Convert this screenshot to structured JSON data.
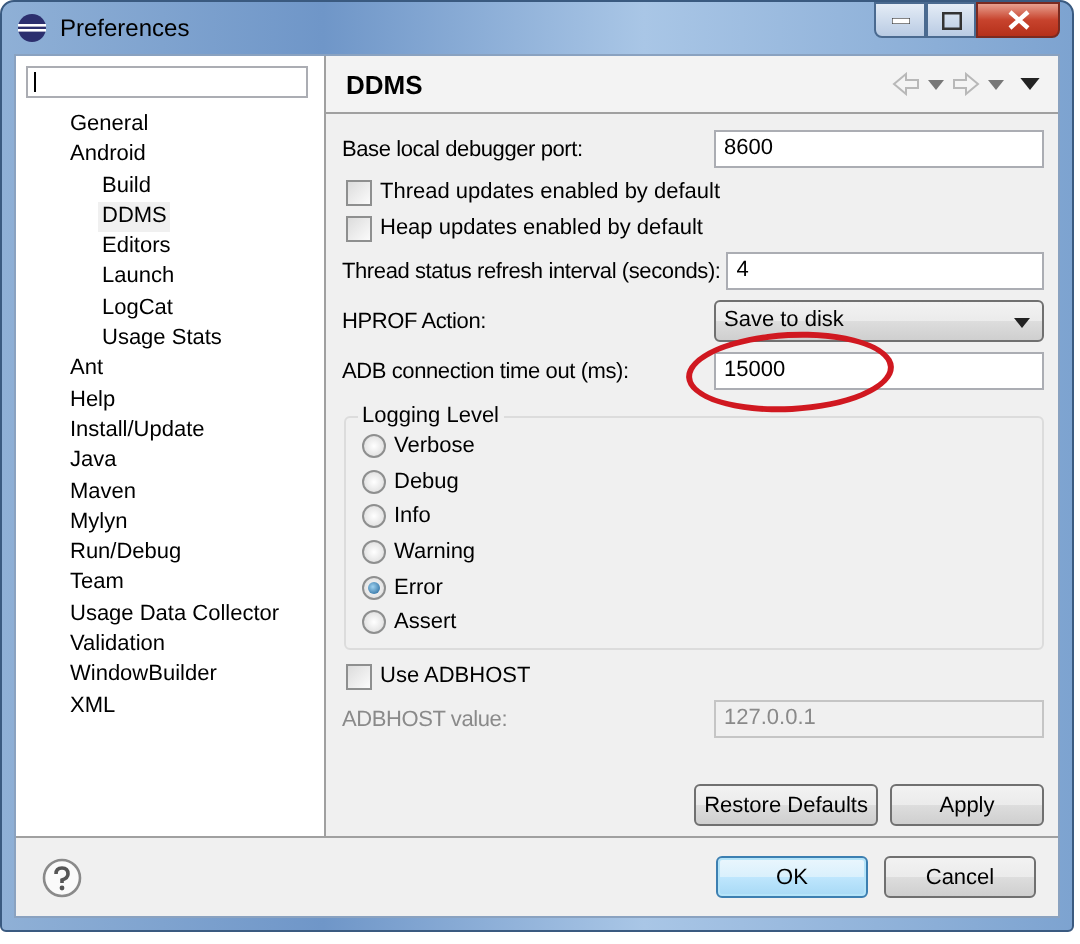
{
  "window": {
    "title": "Preferences"
  },
  "tree": [
    {
      "label": "General",
      "selected": false
    },
    {
      "label": "Android",
      "selected": false,
      "children": [
        {
          "label": "Build",
          "selected": false
        },
        {
          "label": "DDMS",
          "selected": true
        },
        {
          "label": "Editors",
          "selected": false
        },
        {
          "label": "Launch",
          "selected": false
        },
        {
          "label": "LogCat",
          "selected": false
        },
        {
          "label": "Usage Stats",
          "selected": false
        }
      ]
    },
    {
      "label": "Ant",
      "selected": false
    },
    {
      "label": "Help",
      "selected": false
    },
    {
      "label": "Install/Update",
      "selected": false
    },
    {
      "label": "Java",
      "selected": false
    },
    {
      "label": "Maven",
      "selected": false
    },
    {
      "label": "Mylyn",
      "selected": false
    },
    {
      "label": "Run/Debug",
      "selected": false
    },
    {
      "label": "Team",
      "selected": false
    },
    {
      "label": "Usage Data Collector",
      "selected": false
    },
    {
      "label": "Validation",
      "selected": false
    },
    {
      "label": "WindowBuilder",
      "selected": false
    },
    {
      "label": "XML",
      "selected": false
    }
  ],
  "page": {
    "title": "DDMS",
    "rows": [
      {
        "kind": "text",
        "label": "Base local debugger port:",
        "value": "8600",
        "circled": false
      },
      {
        "kind": "checkbox",
        "label": "Thread updates enabled by default",
        "checked": false
      },
      {
        "kind": "checkbox",
        "label": "Heap updates enabled by default",
        "checked": false
      },
      {
        "kind": "text",
        "label": "Thread status refresh interval (seconds):",
        "value": "4",
        "circled": false
      },
      {
        "kind": "select",
        "label": "HPROF Action:",
        "value": "Save to disk"
      },
      {
        "kind": "text",
        "label": "ADB connection time out (ms):",
        "value": "15000",
        "circled": true
      }
    ],
    "logging": {
      "title": "Logging Level",
      "options": [
        {
          "label": "Verbose",
          "selected": false
        },
        {
          "label": "Debug",
          "selected": false
        },
        {
          "label": "Info",
          "selected": false
        },
        {
          "label": "Warning",
          "selected": false
        },
        {
          "label": "Error",
          "selected": true
        },
        {
          "label": "Assert",
          "selected": false
        }
      ]
    },
    "adbhost": {
      "label": "Use ADBHOST",
      "checked": false
    },
    "adbhost_value": {
      "label": "ADBHOST value:",
      "value": "127.0.0.1",
      "disabled": true
    },
    "buttons": [
      "Restore Defaults",
      "Apply"
    ]
  },
  "dialog_buttons": [
    {
      "label": "OK",
      "default": true
    },
    {
      "label": "Cancel",
      "default": false
    }
  ]
}
